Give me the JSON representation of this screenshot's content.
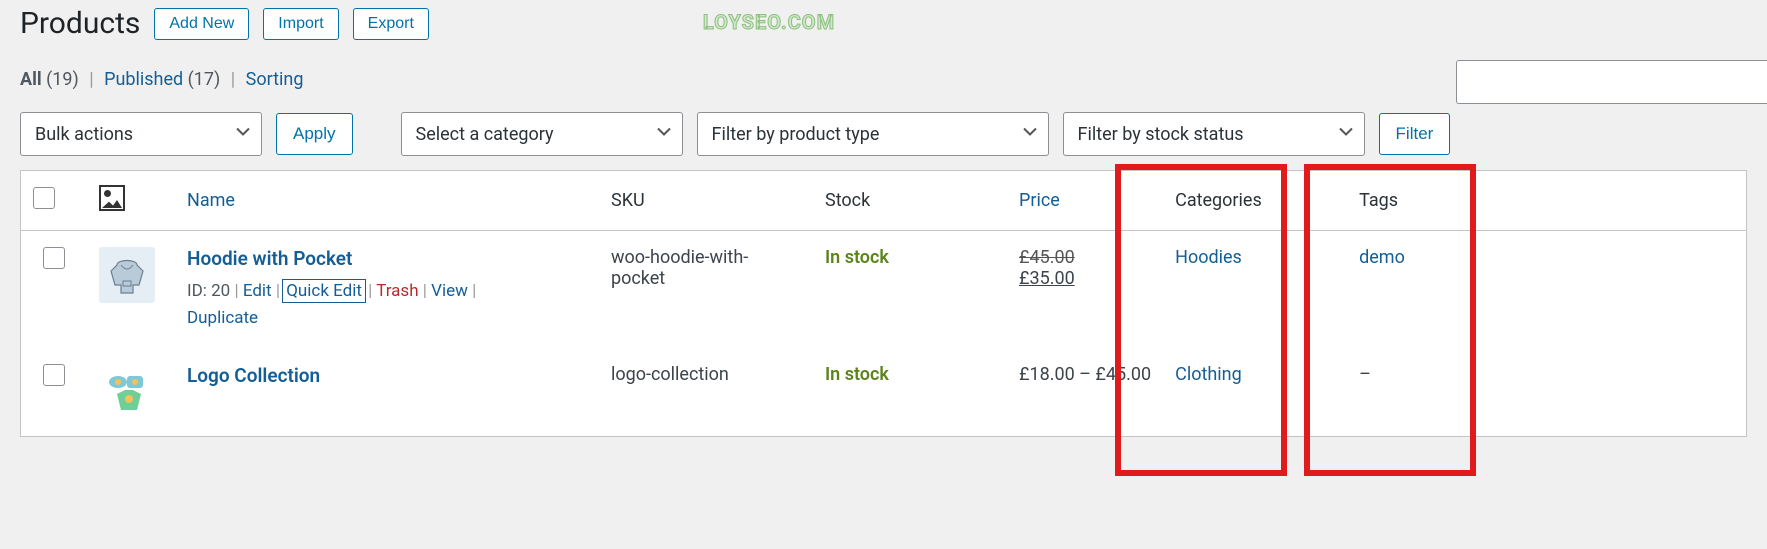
{
  "header": {
    "title": "Products",
    "add_new": "Add New",
    "import": "Import",
    "export": "Export",
    "watermark": "LOYSEO.COM"
  },
  "subnav": {
    "all_label": "All",
    "all_count": "(19)",
    "published_label": "Published",
    "published_count": "(17)",
    "sorting": "Sorting"
  },
  "filters": {
    "bulk": "Bulk actions",
    "apply": "Apply",
    "category": "Select a category",
    "type": "Filter by product type",
    "stock": "Filter by stock status",
    "filter": "Filter"
  },
  "columns": {
    "name": "Name",
    "sku": "SKU",
    "stock": "Stock",
    "price": "Price",
    "categories": "Categories",
    "tags": "Tags"
  },
  "rows": [
    {
      "title": "Hoodie with Pocket",
      "id_label": "ID: 20",
      "actions": {
        "edit": "Edit",
        "quick_edit": "Quick Edit",
        "trash": "Trash",
        "view": "View",
        "duplicate": "Duplicate"
      },
      "sku": "woo-hoodie-with-pocket",
      "stock": "In stock",
      "price_old": "£45.00",
      "price_new": "£35.00",
      "category": "Hoodies",
      "tag": "demo"
    },
    {
      "title": "Logo Collection",
      "sku": "logo-collection",
      "stock": "In stock",
      "price_range": "£18.00 – £45.00",
      "category": "Clothing",
      "tag": "–"
    }
  ]
}
